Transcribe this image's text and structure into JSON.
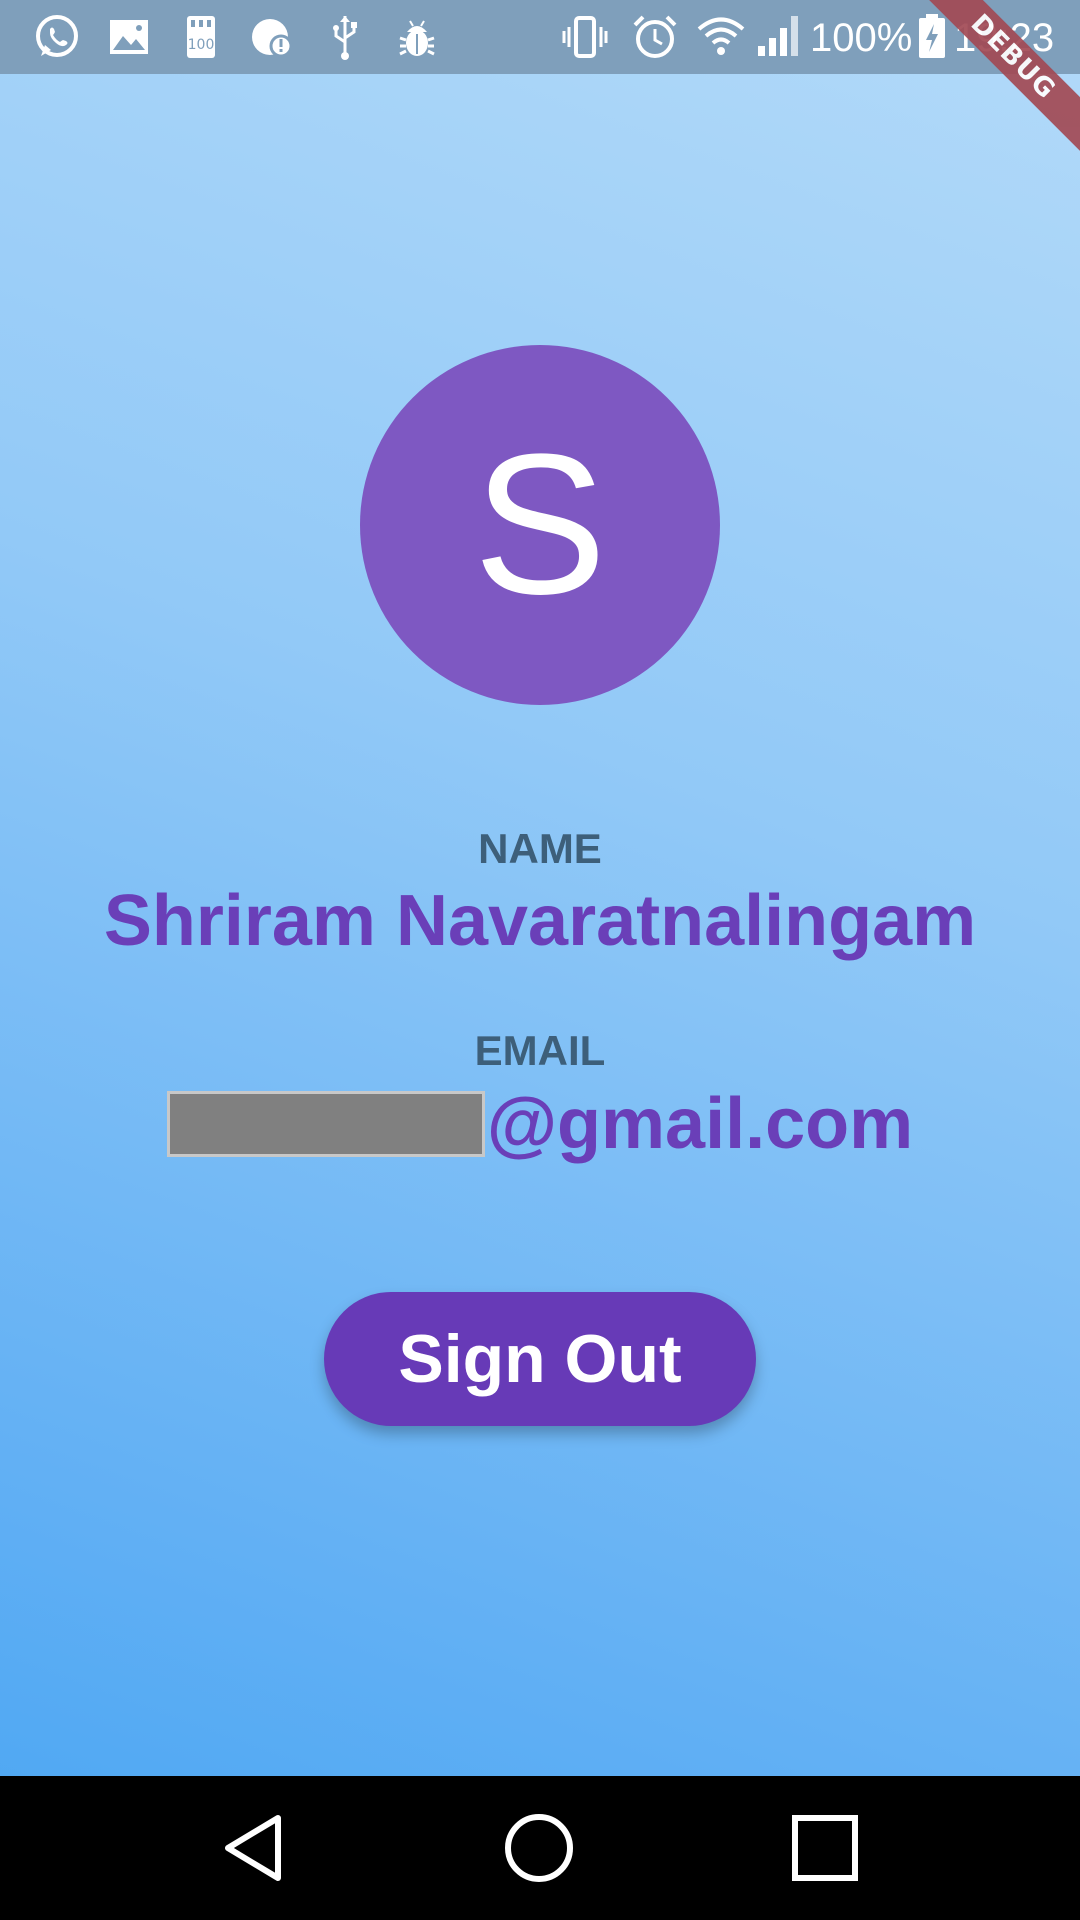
{
  "status_bar": {
    "battery_percent": "100%",
    "time": "19:23",
    "left_icons": [
      "whatsapp-icon",
      "gallery-icon",
      "sd-card-icon",
      "alert-icon",
      "usb-icon",
      "android-debug-icon"
    ],
    "right_icons": [
      "vibrate-icon",
      "alarm-icon",
      "wifi-icon",
      "signal-icon",
      "battery-charging-icon"
    ]
  },
  "debug_banner": "DEBUG",
  "profile": {
    "avatar_letter": "S",
    "avatar_color": "#7e58c2",
    "name_label": "NAME",
    "name_value": "Shriram Navaratnalingam",
    "email_label": "EMAIL",
    "email_domain": "@gmail.com"
  },
  "actions": {
    "sign_out_label": "Sign Out",
    "button_color": "#673ab7"
  },
  "nav_bar": {
    "buttons": [
      "back-icon",
      "home-icon",
      "recents-icon"
    ]
  }
}
